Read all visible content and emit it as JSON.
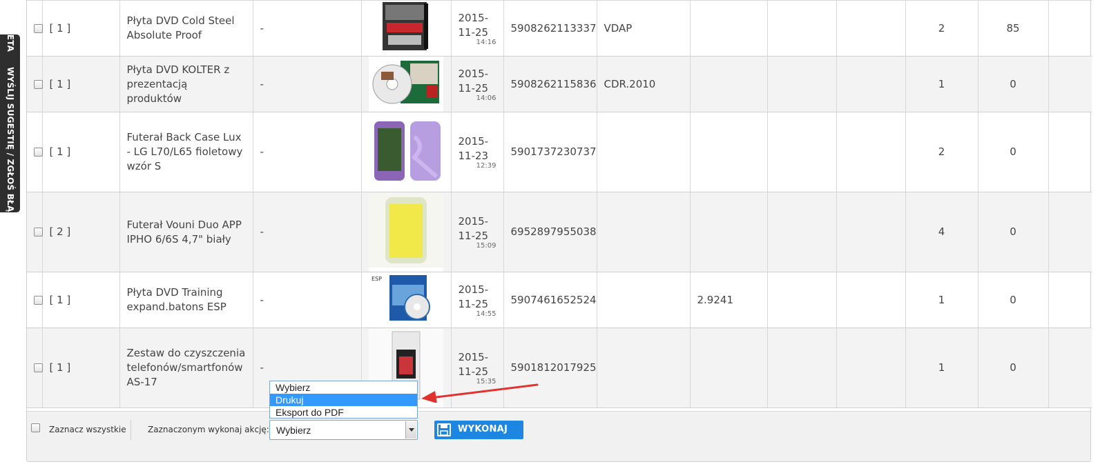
{
  "sidebar_tab": {
    "beta": "BETA",
    "label": "WYŚLIJ SUGESTIĘ / ZGŁOŚ BŁĄD"
  },
  "rows": [
    {
      "qty": "[ 1 ]",
      "name": "Płyta DVD Cold Steel Absolute Proof",
      "dash": "-",
      "image": "dvd-cold-steel-image",
      "date": "2015-11-25",
      "time": "14:16",
      "ean": "5908262113337",
      "code": "VDAP",
      "col9": "",
      "col10": "",
      "n1": "2",
      "n2": "85"
    },
    {
      "qty": "[ 1 ]",
      "name": "Płyta DVD KOLTER z prezentacją produktów",
      "dash": "-",
      "image": "dvd-kolter-image",
      "date": "2015-11-25",
      "time": "14:06",
      "ean": "5908262115836",
      "code": "CDR.2010",
      "col9": "",
      "col10": "",
      "n1": "1",
      "n2": "0"
    },
    {
      "qty": "[ 1 ]",
      "name": "Futerał Back Case Lux - LG L70/L65 fioletowy wzór S",
      "dash": "-",
      "image": "purple-phone-case-image",
      "date": "2015-11-23",
      "time": "12:39",
      "ean": "5901737230737",
      "code": "",
      "col9": "",
      "col10": "",
      "n1": "2",
      "n2": "0"
    },
    {
      "qty": "[ 2 ]",
      "name": "Futerał Vouni Duo APP IPHO 6/6S 4,7\" biały",
      "dash": "-",
      "image": "yellow-phone-case-image",
      "date": "2015-11-25",
      "time": "15:09",
      "ean": "6952897955038",
      "code": "",
      "col9": "",
      "col10": "",
      "n1": "4",
      "n2": "0"
    },
    {
      "qty": "[ 1 ]",
      "name": "Płyta DVD Training expand.batons ESP",
      "dash": "-",
      "image": "dvd-esp-image",
      "date": "2015-11-25",
      "time": "14:55",
      "ean": "5907461652524",
      "code": "",
      "col9": "2.9241",
      "col10": "",
      "n1": "1",
      "n2": "0"
    },
    {
      "qty": "[ 1 ]",
      "name": "Zestaw do czyszczenia telefonów/smartfonów AS-17",
      "dash": "-",
      "image": "cleaning-kit-image",
      "date": "2015-11-25",
      "time": "15:35",
      "ean": "5901812017925",
      "code": "",
      "col9": "",
      "col10": "",
      "n1": "1",
      "n2": "0"
    }
  ],
  "footer": {
    "select_all_label": "Zaznacz wszystkie",
    "action_label": "Zaznaczonym wykonaj akcję:",
    "select_value": "Wybierz",
    "options": [
      "Wybierz",
      "Drukuj",
      "Eksport do PDF"
    ],
    "highlighted_option": "Drukuj",
    "execute_label": "WYKONAJ"
  },
  "colors": {
    "accent": "#1d86e0",
    "highlight": "#3399ff",
    "annotation_arrow": "#e0322f"
  }
}
